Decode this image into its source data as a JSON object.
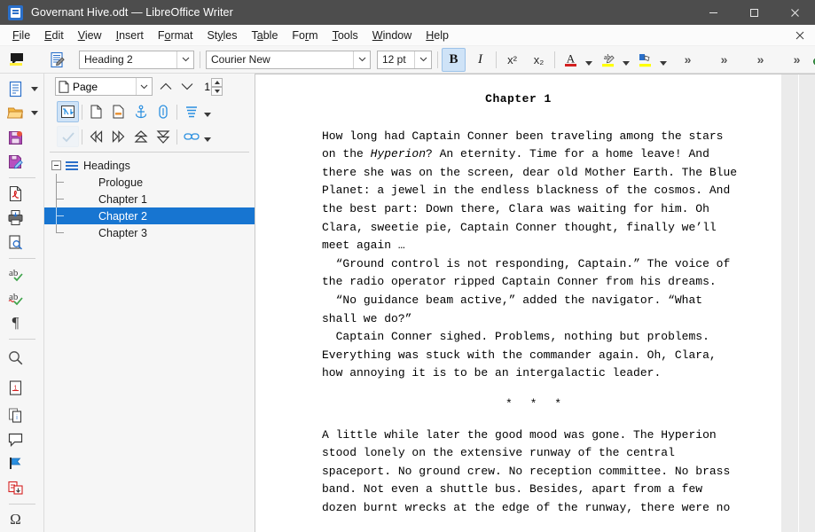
{
  "window": {
    "title": "Governant Hive.odt — LibreOffice Writer",
    "app_icon": "writer-document-icon",
    "minimize_label": "Minimize",
    "maximize_label": "Maximize",
    "close_label": "Close"
  },
  "menubar": {
    "items": [
      {
        "label": "File",
        "mnemonic": "F"
      },
      {
        "label": "Edit",
        "mnemonic": "E"
      },
      {
        "label": "View",
        "mnemonic": "V"
      },
      {
        "label": "Insert",
        "mnemonic": "I"
      },
      {
        "label": "Format",
        "mnemonic": "o"
      },
      {
        "label": "Styles",
        "mnemonic": "y"
      },
      {
        "label": "Table",
        "mnemonic": "a"
      },
      {
        "label": "Form",
        "mnemonic": "r"
      },
      {
        "label": "Tools",
        "mnemonic": "T"
      },
      {
        "label": "Window",
        "mnemonic": "W"
      },
      {
        "label": "Help",
        "mnemonic": "H"
      }
    ],
    "document_close": "✕"
  },
  "toolbar": {
    "comment_label": "Insert Comment",
    "track_changes_label": "Track Changes",
    "paragraph_style": {
      "value": "Heading 2",
      "placeholder": "Paragraph Style"
    },
    "font_name": {
      "value": "Courier New",
      "placeholder": "Font Name"
    },
    "font_size": {
      "value": "12 pt",
      "placeholder": "Font Size"
    },
    "bold_label": "B",
    "bold_active": true,
    "italic_label": "I",
    "superscript_label": "x²",
    "subscript_label": "x₂",
    "font_color_label": "A",
    "font_color": "#d32020",
    "highlight_color": "#ffff00",
    "overflow_label": "»",
    "overflow_count": 4,
    "find_label": "Find and Replace"
  },
  "rail": {
    "items": [
      {
        "name": "new-document-icon",
        "has_dropdown": true
      },
      {
        "name": "open-document-icon",
        "has_dropdown": true
      },
      {
        "name": "save-icon",
        "has_dropdown": false
      },
      {
        "name": "save-as-icon",
        "has_dropdown": false
      },
      {
        "name": "export-pdf-icon",
        "has_dropdown": false
      },
      {
        "name": "print-icon",
        "has_dropdown": false
      },
      {
        "name": "print-preview-icon",
        "has_dropdown": false
      },
      {
        "name": "spelling-icon",
        "has_dropdown": false
      },
      {
        "name": "auto-spellcheck-icon",
        "has_dropdown": false
      },
      {
        "name": "formatting-marks-icon",
        "has_dropdown": false
      },
      {
        "name": "find-icon",
        "has_dropdown": false
      },
      {
        "name": "footnote-icon",
        "has_dropdown": false
      },
      {
        "name": "endnote-icon",
        "has_dropdown": false
      },
      {
        "name": "comment-icon",
        "has_dropdown": false
      },
      {
        "name": "bookmark-icon",
        "has_dropdown": false
      },
      {
        "name": "cross-reference-icon",
        "has_dropdown": false
      },
      {
        "name": "special-character-icon",
        "has_dropdown": false
      }
    ]
  },
  "navigator": {
    "jump_selector": {
      "value": "Page",
      "placeholder": "Navigate By"
    },
    "page_number": "1",
    "previous_label": "Previous",
    "next_label": "Next",
    "toolbar_row1": [
      {
        "name": "toggle-master-view-icon",
        "active": true
      },
      {
        "name": "navigation-page-icon",
        "active": false
      },
      {
        "name": "set-reminder-icon",
        "active": false
      },
      {
        "name": "anchor-icon",
        "active": false
      },
      {
        "name": "attach-icon",
        "active": false
      },
      {
        "name": "heading-levels-icon",
        "active": false
      }
    ],
    "toolbar_row2": [
      {
        "name": "content-toggle-icon",
        "disabled": true
      },
      {
        "name": "promote-chapter-icon",
        "active": false
      },
      {
        "name": "demote-chapter-icon",
        "active": false
      },
      {
        "name": "promote-level-icon",
        "active": false
      },
      {
        "name": "demote-level-icon",
        "active": false
      },
      {
        "name": "link-icon",
        "active": false
      }
    ],
    "tree": {
      "root": {
        "label": "Headings",
        "expanded": true,
        "icon": "headings-icon"
      },
      "children": [
        {
          "label": "Prologue",
          "selected": false
        },
        {
          "label": "Chapter 1",
          "selected": false
        },
        {
          "label": "Chapter 2",
          "selected": true
        },
        {
          "label": "Chapter 3",
          "selected": false
        }
      ]
    },
    "selection_color": "#1775d1"
  },
  "document": {
    "heading": "Chapter  1",
    "paragraphs": [
      {
        "kind": "body",
        "lines": [
          "How long had Captain Conner been traveling among the stars",
          "on the |Hyperion|? An eternity. Time for a home leave! And",
          "there she was on the screen, dear old Mother Earth. The Blue",
          "Planet: a jewel in the endless blackness of the cosmos. And",
          "the best part: Down there, Clara was waiting for him. Oh",
          "Clara, sweetie pie, Captain Conner thought, finally we’ll",
          "meet again …"
        ]
      },
      {
        "kind": "body",
        "lines": [
          "  “Ground control is not responding, Captain.” The voice of",
          "the radio operator ripped Captain Conner from his dreams."
        ]
      },
      {
        "kind": "body",
        "lines": [
          "  “No guidance beam active,” added the navigator. “What",
          "shall we do?”"
        ]
      },
      {
        "kind": "body",
        "lines": [
          "  Captain Conner sighed. Problems, nothing but problems.",
          "Everything was stuck with the commander again. Oh, Clara,",
          "how annoying it is to be an intergalactic leader."
        ]
      },
      {
        "kind": "separator",
        "text": "* * *"
      },
      {
        "kind": "body",
        "lines": [
          "A little while later the good mood was gone. The Hyperion",
          "stood lonely on the extensive runway of the central",
          "spaceport. No ground crew. No reception committee. No brass",
          "band. Not even a shuttle bus. Besides, apart from a few",
          "dozen burnt wrecks at the edge of the runway, there were no"
        ]
      }
    ]
  }
}
